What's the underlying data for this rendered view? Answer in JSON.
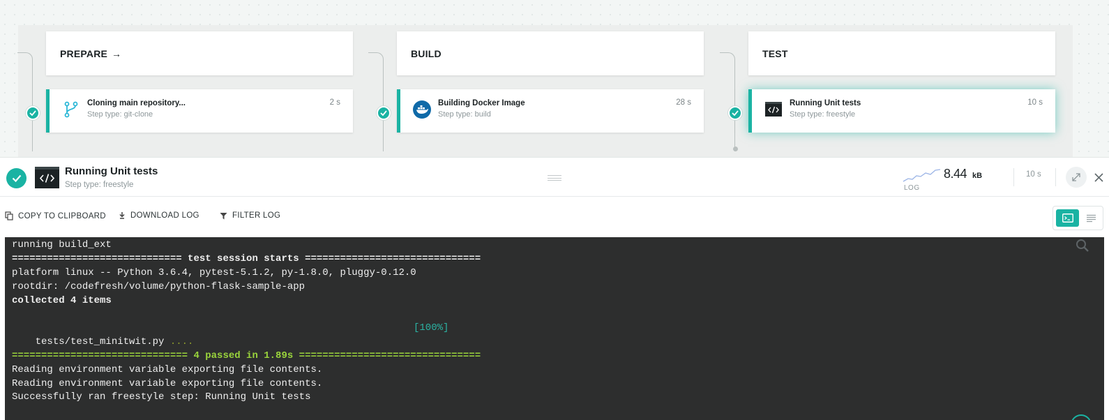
{
  "pipeline": {
    "stages": [
      {
        "label": "PREPARE",
        "arrow": "→",
        "step": {
          "title": "Cloning main repository...",
          "subtitle": "Step type: git-clone",
          "duration": "2 s",
          "icon": "git-branch-icon"
        }
      },
      {
        "label": "BUILD",
        "arrow": "",
        "step": {
          "title": "Building Docker Image",
          "subtitle": "Step type: build",
          "duration": "28 s",
          "icon": "docker-icon"
        }
      },
      {
        "label": "TEST",
        "arrow": "",
        "step": {
          "title": "Running Unit tests",
          "subtitle": "Step type: freestyle",
          "duration": "10 s",
          "icon": "terminal-icon"
        }
      }
    ]
  },
  "step_header": {
    "title": "Running Unit tests",
    "subtitle": "Step type: freestyle",
    "log_label": "LOG",
    "log_size": "8.44",
    "log_unit": "kB",
    "duration": "10 s"
  },
  "toolbar": {
    "copy_label": "COPY TO CLIPBOARD",
    "download_label": "DOWNLOAD LOG",
    "filter_label": "FILTER LOG"
  },
  "log": {
    "line1": "running build_ext",
    "line2": "============================= test session starts ==============================",
    "line3": "platform linux -- Python 3.6.4, pytest-5.1.2, py-1.8.0, pluggy-0.12.0",
    "line4": "rootdir: /codefresh/volume/python-flask-sample-app",
    "line5": "collected 4 items",
    "line7_file": "tests/test_minitwit.py ",
    "line7_dots": "....",
    "line7_pct": "[100%]",
    "line9": "============================== 4 passed in 1.89s ===============================",
    "line10": "Reading environment variable exporting file contents.",
    "line11": "Reading environment variable exporting file contents.",
    "line12": "Successfully ran freestyle step: Running Unit tests"
  },
  "colors": {
    "accent": "#1ab3a3",
    "console_bg": "#2d2e2e",
    "pass_green": "#9ad43c"
  }
}
